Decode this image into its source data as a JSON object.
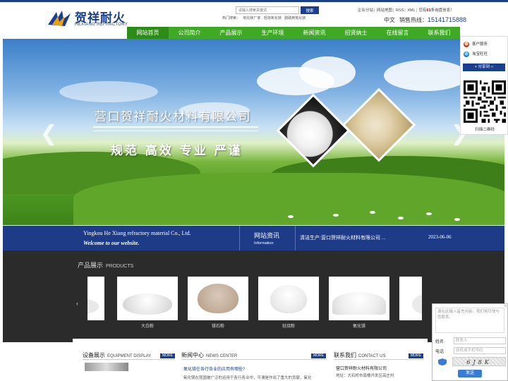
{
  "header": {
    "logo_cn": "贺祥耐火",
    "logo_en": "HEXIANG REFRACTORY",
    "search_placeholder": "请输入搜索关键词",
    "search_button": "搜索",
    "hot_label": "热门搜索：",
    "hot_items": [
      "氧化镁厂家",
      "轻烧氧化镁",
      "脱硫用氧化镁"
    ],
    "top_links": [
      "企业分站",
      "网站地图",
      "RSS",
      "XML"
    ],
    "notice_prefix": "您有",
    "notice_count": "61",
    "notice_suffix": "条询盘信息！",
    "lang": "中文",
    "hotline_label": "销售热线：",
    "hotline_number": "15141715888"
  },
  "nav": {
    "items": [
      "网站首页",
      "公司简介",
      "产品展示",
      "生产环境",
      "新闻资讯",
      "招贤纳士",
      "在线留言",
      "联系我们"
    ]
  },
  "banner": {
    "title": "营口贺祥耐火材料有限公司",
    "slogan": "规范 高效 专业 严谨",
    "prev": "❮",
    "next": "❯"
  },
  "strip": {
    "company_en": "Yingkou He Xiang refractory material Co., Ltd.",
    "welcome": "Welcome to our website.",
    "news_cn": "网站资讯",
    "news_en": "Information",
    "news_item": "清洁生产:营口贺祥耐火材料有限公司 ...",
    "news_date": "2023-06-06"
  },
  "products": {
    "title_cn": "产品展示",
    "title_en": "PRODUCTS",
    "prev": "‹",
    "items": [
      {
        "name": "大白粉"
      },
      {
        "name": "镁石粉"
      },
      {
        "name": "轻烧粉"
      },
      {
        "name": "氧化镁"
      }
    ]
  },
  "bottom": {
    "equip_cn": "设备展示",
    "equip_en": "EQUIPMENT DISPLAY",
    "news_cn": "新闻中心",
    "news_en": "NEWS CENTER",
    "contact_cn": "联系我们",
    "contact_en": "CONTACT US",
    "more": "MORE",
    "news_title": "氧化镁在各行各业的应用有哪些?",
    "news_excerpt": "氧化镁在我国被广泛的运用于各行各业中，可谓是作出了重大的贡献，氧化",
    "contact_company": "营口贺祥耐火材料有限公司",
    "contact_address": "地址：大石桥市南楼开发区高庄村"
  },
  "float": {
    "service": "客户服务",
    "taobao": "淘宝旺旺",
    "share": "分享到",
    "qr_label": "扫描二维码"
  },
  "message": {
    "placeholder": "请在此输入留言内容，我们将尽快与您联系。",
    "name_label": "姓名",
    "name_placeholder": "联系人",
    "phone_label": "电话",
    "phone_placeholder": "座机或手机号码",
    "captcha": "6J8K",
    "send": "发送",
    "close": "×"
  }
}
